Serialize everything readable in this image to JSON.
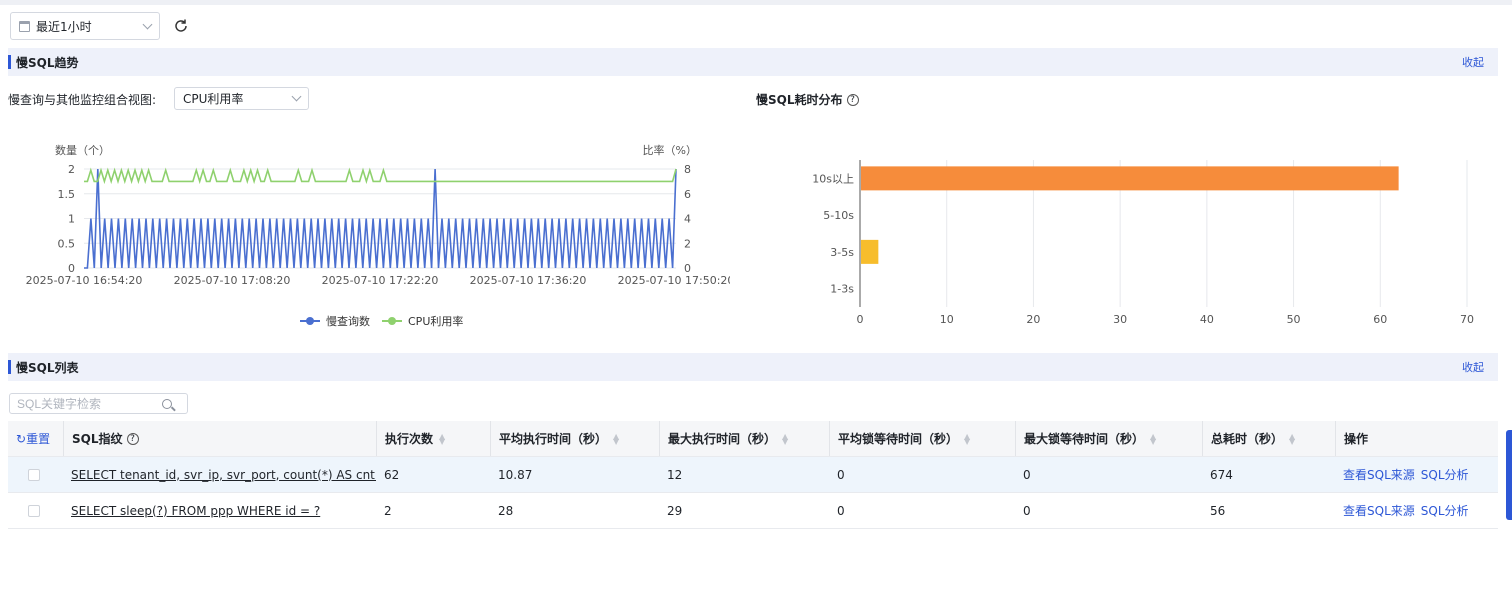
{
  "toolbar": {
    "time_range": "最近1小时"
  },
  "trend_section": {
    "title": "慢SQL趋势",
    "collapse": "收起"
  },
  "combo": {
    "label": "慢查询与其他监控组合视图:",
    "selected": "CPU利用率"
  },
  "distribution": {
    "title": "慢SQL耗时分布"
  },
  "list_section": {
    "title": "慢SQL列表",
    "collapse": "收起"
  },
  "search": {
    "placeholder": "SQL关键字检索"
  },
  "table": {
    "reset": "重置",
    "columns": [
      "SQL指纹",
      "执行次数",
      "平均执行时间（秒）",
      "最大执行时间（秒）",
      "平均锁等待时间（秒）",
      "最大锁等待时间（秒）",
      "总耗时（秒）",
      "操作"
    ],
    "rows": [
      {
        "sql": "SELECT tenant_id, svr_ip, svr_port, count(*) AS cnt FRO...",
        "count": "62",
        "avg": "10.87",
        "max": "12",
        "avg_lock": "0",
        "max_lock": "0",
        "total": "674",
        "op1": "查看SQL来源",
        "op2": "SQL分析"
      },
      {
        "sql": "SELECT sleep(?) FROM ppp WHERE id = ?",
        "count": "2",
        "avg": "28",
        "max": "29",
        "avg_lock": "0",
        "max_lock": "0",
        "total": "56",
        "op1": "查看SQL来源",
        "op2": "SQL分析"
      }
    ]
  },
  "chart_data": [
    {
      "type": "line",
      "left_axis_label": "数量（个）",
      "right_axis_label": "比率（%）",
      "y_left_ticks": [
        "2",
        "1.5",
        "1",
        "0.5",
        "0"
      ],
      "y_right_ticks": [
        "8",
        "6",
        "4",
        "2",
        "0"
      ],
      "ylim_left": [
        0,
        2
      ],
      "ylim_right": [
        0,
        8
      ],
      "x_ticks": [
        "2025-07-10 16:54:20",
        "2025-07-10 17:08:20",
        "2025-07-10 17:22:20",
        "2025-07-10 17:36:20",
        "2025-07-10 17:50:20"
      ],
      "series": [
        {
          "name": "慢查询数",
          "color": "#4a6fd0",
          "axis": "left",
          "values": [
            0,
            0,
            1,
            0,
            2,
            0,
            1,
            0,
            1,
            0,
            1,
            0,
            1,
            0,
            1,
            0,
            1,
            0,
            1,
            0,
            1,
            0,
            1,
            0,
            1,
            0,
            1,
            0,
            1,
            0,
            1,
            0,
            1,
            0,
            1,
            0,
            1,
            0,
            1,
            0,
            1,
            0,
            1,
            0,
            1,
            0,
            1,
            0,
            1,
            0,
            1,
            0,
            1,
            0,
            1,
            0,
            1,
            0,
            1,
            0,
            1,
            0,
            1,
            0,
            1,
            0,
            1,
            0,
            1,
            0,
            1,
            0,
            1,
            0,
            1,
            0,
            1,
            0,
            1,
            0,
            1,
            0,
            1,
            0,
            1,
            0,
            1,
            0,
            1,
            0,
            1,
            0,
            1,
            0,
            1,
            0,
            1,
            0,
            1,
            0,
            1,
            0,
            2,
            0,
            1,
            0,
            1,
            0,
            1,
            0,
            1,
            0,
            1,
            0,
            1,
            0,
            1,
            0,
            1,
            0,
            1,
            0,
            1,
            0,
            1,
            0,
            1,
            0,
            1,
            0,
            1,
            0,
            1,
            0,
            1,
            0,
            1,
            0,
            1,
            0,
            1,
            0,
            1,
            0,
            1,
            0,
            1,
            0,
            1,
            0,
            1,
            0,
            1,
            0,
            1,
            0,
            1,
            0,
            1,
            0,
            1,
            0,
            1,
            0,
            1,
            0,
            1,
            0,
            1,
            0,
            1,
            0,
            2
          ]
        },
        {
          "name": "CPU利用率",
          "color": "#8fd16e",
          "axis": "right",
          "values": [
            7,
            7,
            7.9,
            7,
            7,
            7.9,
            7,
            7.9,
            7,
            7.9,
            7,
            7.9,
            7,
            7.9,
            7,
            7.9,
            7,
            7.9,
            7,
            7.9,
            7,
            7,
            7,
            7,
            7.9,
            7,
            7,
            7,
            7,
            7,
            7,
            7,
            7,
            7.9,
            7,
            7.9,
            7,
            7,
            7.9,
            7,
            7,
            7,
            7,
            7.9,
            7,
            7,
            7,
            7.9,
            7,
            7.9,
            7,
            7.9,
            7,
            7,
            7.9,
            7,
            7,
            7,
            7,
            7,
            7,
            7,
            7,
            7.9,
            7,
            7,
            7,
            7.9,
            7,
            7,
            7,
            7,
            7,
            7,
            7,
            7,
            7,
            7,
            7.9,
            7,
            7,
            7,
            7.9,
            7,
            7.9,
            7,
            7,
            7,
            7.9,
            7,
            7,
            7,
            7,
            7,
            7,
            7,
            7,
            7,
            7,
            7,
            7,
            7,
            7,
            7,
            7,
            7,
            7,
            7,
            7,
            7,
            7,
            7,
            7,
            7,
            7,
            7,
            7,
            7,
            7,
            7,
            7,
            7,
            7,
            7,
            7,
            7,
            7,
            7,
            7,
            7,
            7,
            7,
            7,
            7,
            7,
            7,
            7,
            7,
            7,
            7,
            7,
            7,
            7,
            7,
            7,
            7,
            7,
            7,
            7,
            7,
            7,
            7,
            7,
            7,
            7,
            7,
            7,
            7,
            7,
            7,
            7,
            7,
            7,
            7,
            7,
            7,
            7,
            7,
            7,
            7,
            7,
            7,
            7,
            7,
            8
          ]
        }
      ]
    },
    {
      "type": "bar",
      "orientation": "horizontal",
      "categories": [
        "10s以上",
        "5-10s",
        "3-5s",
        "1-3s"
      ],
      "values": [
        62,
        0,
        2,
        0
      ],
      "colors": [
        "#f68c3b",
        "#f68c3b",
        "#f7bd2c",
        "#f68c3b"
      ],
      "x_ticks": [
        "0",
        "10",
        "20",
        "30",
        "40",
        "50",
        "60",
        "70"
      ],
      "xlim": [
        0,
        70
      ]
    }
  ]
}
